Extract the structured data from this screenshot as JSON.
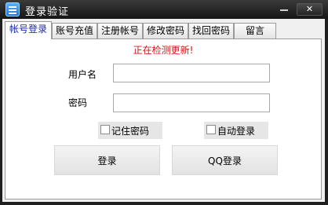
{
  "window": {
    "title": "登录验证",
    "close_label": "✕"
  },
  "tabs": [
    {
      "label": "帐号登录",
      "active": true
    },
    {
      "label": "账号充值",
      "active": false
    },
    {
      "label": "注册帐号",
      "active": false
    },
    {
      "label": "修改密码",
      "active": false
    },
    {
      "label": "找回密码",
      "active": false
    },
    {
      "label": "留言",
      "active": false
    }
  ],
  "login": {
    "status_text": "正在检测更新!",
    "username_label": "用户名",
    "username_value": "",
    "password_label": "密码",
    "password_value": "",
    "remember_label": "记住密码",
    "remember_checked": false,
    "autologin_label": "自动登录",
    "autologin_checked": false,
    "login_button": "登录",
    "qq_login_button": "QQ登录"
  },
  "colors": {
    "status_text": "#d01818",
    "active_tab_text": "#1a2a9a",
    "title_bar": "#1f1f1f"
  }
}
